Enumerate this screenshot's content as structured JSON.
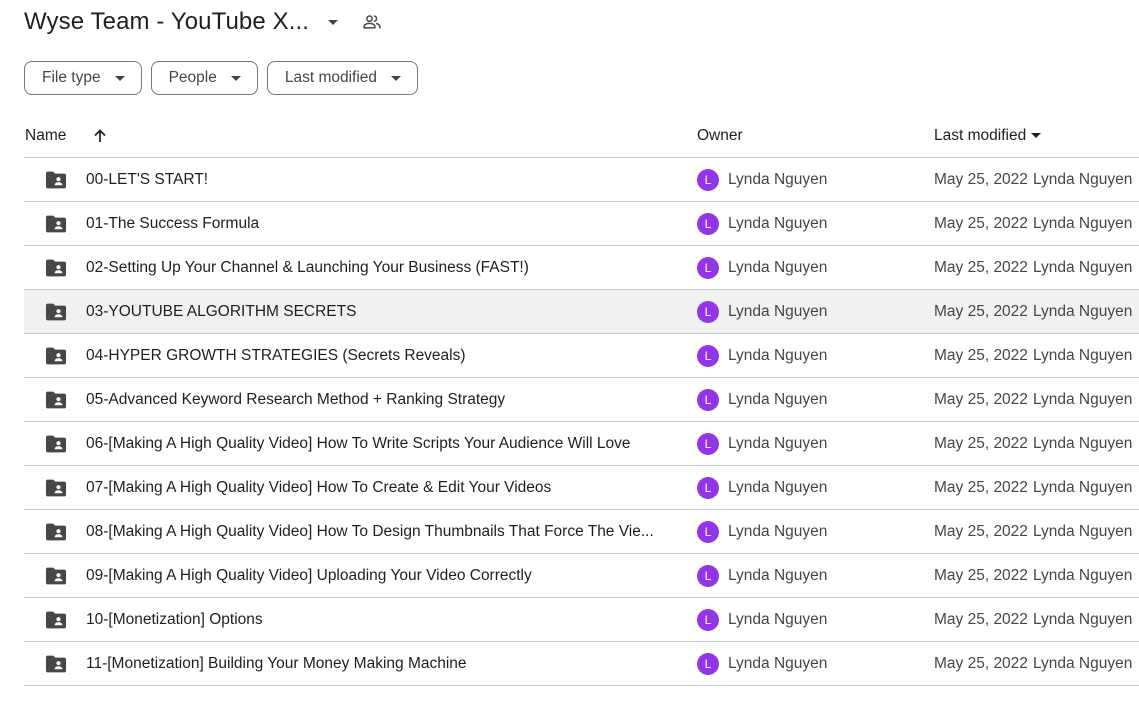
{
  "header": {
    "title": "Wyse Team - YouTube X...",
    "title_caret_icon": "arrow-drop-down-icon",
    "shared_icon": "people-shared-icon"
  },
  "filters": [
    {
      "label": "File type"
    },
    {
      "label": "People"
    },
    {
      "label": "Last modified"
    }
  ],
  "table": {
    "columns": {
      "name": "Name",
      "owner": "Owner",
      "modified": "Last modified"
    },
    "sort": {
      "column": "name",
      "direction": "ascending",
      "icon": "arrow-up-icon"
    },
    "rows": [
      {
        "name": "00-LET'S START!",
        "owner": "Lynda Nguyen",
        "avatar": "L",
        "modified": "May 25, 2022",
        "modified_by": "Lynda Nguyen",
        "selected": false
      },
      {
        "name": "01-The Success Formula",
        "owner": "Lynda Nguyen",
        "avatar": "L",
        "modified": "May 25, 2022",
        "modified_by": "Lynda Nguyen",
        "selected": false
      },
      {
        "name": "02-Setting Up Your Channel & Launching Your Business (FAST!)",
        "owner": "Lynda Nguyen",
        "avatar": "L",
        "modified": "May 25, 2022",
        "modified_by": "Lynda Nguyen",
        "selected": false
      },
      {
        "name": "03-YOUTUBE ALGORITHM SECRETS",
        "owner": "Lynda Nguyen",
        "avatar": "L",
        "modified": "May 25, 2022",
        "modified_by": "Lynda Nguyen",
        "selected": true
      },
      {
        "name": "04-HYPER GROWTH STRATEGIES (Secrets Reveals)",
        "owner": "Lynda Nguyen",
        "avatar": "L",
        "modified": "May 25, 2022",
        "modified_by": "Lynda Nguyen",
        "selected": false
      },
      {
        "name": "05-Advanced Keyword Research Method + Ranking Strategy",
        "owner": "Lynda Nguyen",
        "avatar": "L",
        "modified": "May 25, 2022",
        "modified_by": "Lynda Nguyen",
        "selected": false
      },
      {
        "name": "06-[Making A High Quality Video] How To Write Scripts Your Audience Will Love",
        "owner": "Lynda Nguyen",
        "avatar": "L",
        "modified": "May 25, 2022",
        "modified_by": "Lynda Nguyen",
        "selected": false
      },
      {
        "name": "07-[Making A High Quality Video] How To Create & Edit Your Videos",
        "owner": "Lynda Nguyen",
        "avatar": "L",
        "modified": "May 25, 2022",
        "modified_by": "Lynda Nguyen",
        "selected": false
      },
      {
        "name": "08-[Making A High Quality Video] How To Design Thumbnails That Force The Vie...",
        "owner": "Lynda Nguyen",
        "avatar": "L",
        "modified": "May 25, 2022",
        "modified_by": "Lynda Nguyen",
        "selected": false
      },
      {
        "name": "09-[Making A High Quality Video] Uploading Your Video Correctly",
        "owner": "Lynda Nguyen",
        "avatar": "L",
        "modified": "May 25, 2022",
        "modified_by": "Lynda Nguyen",
        "selected": false
      },
      {
        "name": "10-[Monetization] Options",
        "owner": "Lynda Nguyen",
        "avatar": "L",
        "modified": "May 25, 2022",
        "modified_by": "Lynda Nguyen",
        "selected": false
      },
      {
        "name": "11-[Monetization] Building Your Money Making Machine",
        "owner": "Lynda Nguyen",
        "avatar": "L",
        "modified": "May 25, 2022",
        "modified_by": "Lynda Nguyen",
        "selected": false
      }
    ]
  },
  "colors": {
    "avatar": "#9334e6",
    "selected_row": "#f0f1f1",
    "divider": "#c7c7c7",
    "folder_icon": "#444746"
  }
}
